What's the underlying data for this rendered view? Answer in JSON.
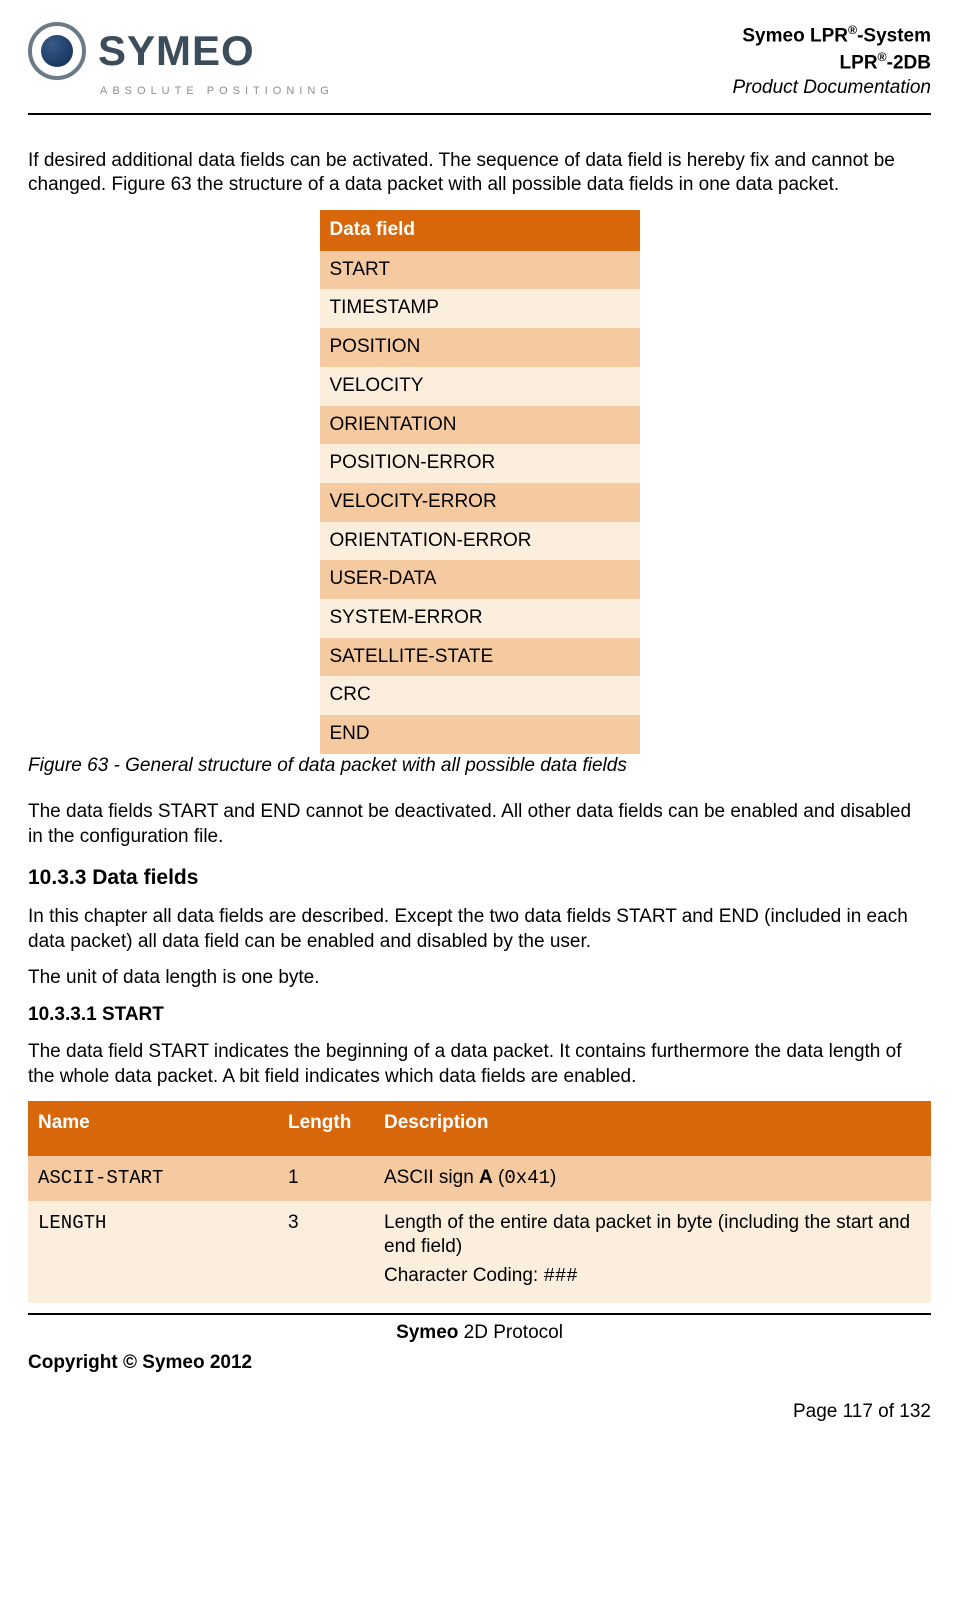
{
  "header": {
    "logo_name": "SYMEO",
    "logo_sub": "ABSOLUTE POSITIONING",
    "line1_pre": "Symeo LPR",
    "line1_sup": "®",
    "line1_post": "-System",
    "line2_pre": "LPR",
    "line2_sup": "®",
    "line2_post": "-2DB",
    "line3": "Product Documentation"
  },
  "intro": "If desired additional data fields can be activated. The sequence of data field is hereby fix and cannot be changed. Figure 63 the structure of a data packet with all possible data fields in one data packet.",
  "datafield_table": {
    "header": "Data field",
    "rows": [
      "START",
      "TIMESTAMP",
      "POSITION",
      "VELOCITY",
      "ORIENTATION",
      "POSITION-ERROR",
      "VELOCITY-ERROR",
      "ORIENTATION-ERROR",
      "USER-DATA",
      "SYSTEM-ERROR",
      "SATELLITE-STATE",
      "CRC",
      "END"
    ]
  },
  "figure_caption": "Figure 63 - General structure of data packet with all possible data fields",
  "para2": "The data fields START and END cannot be deactivated. All other data fields can be enabled and disabled in the configuration file.",
  "section_heading": "10.3.3   Data fields",
  "para3": "In this chapter all data fields are described. Except the two data fields START and END (included in each data packet) all data field can be enabled and disabled by the user.",
  "para4": "The unit of data length is one byte.",
  "sub_heading": "10.3.3.1 START",
  "para5": "The data field START indicates the beginning of a data packet. It contains furthermore the data length of the whole data packet. A bit field indicates which data fields are enabled.",
  "start_table": {
    "headers": [
      "Name",
      "Length",
      "Description"
    ],
    "rows": [
      {
        "name": "ASCII-START",
        "len": "1",
        "desc_pre": "ASCII sign ",
        "desc_bold": "A",
        "desc_paren_open": " (",
        "desc_mono": "0x41",
        "desc_paren_close": ")"
      },
      {
        "name": "LENGTH",
        "len": "3",
        "desc_line1": "Length of the entire data packet in byte (including the start and end field)",
        "desc_line2_label": "Character Coding:  ",
        "desc_line2_mono": "###"
      }
    ]
  },
  "footer": {
    "center_bold": "Symeo",
    "center_rest": " 2D Protocol",
    "copyright": "Copyright © Symeo 2012",
    "page": "Page 117 of 132"
  }
}
